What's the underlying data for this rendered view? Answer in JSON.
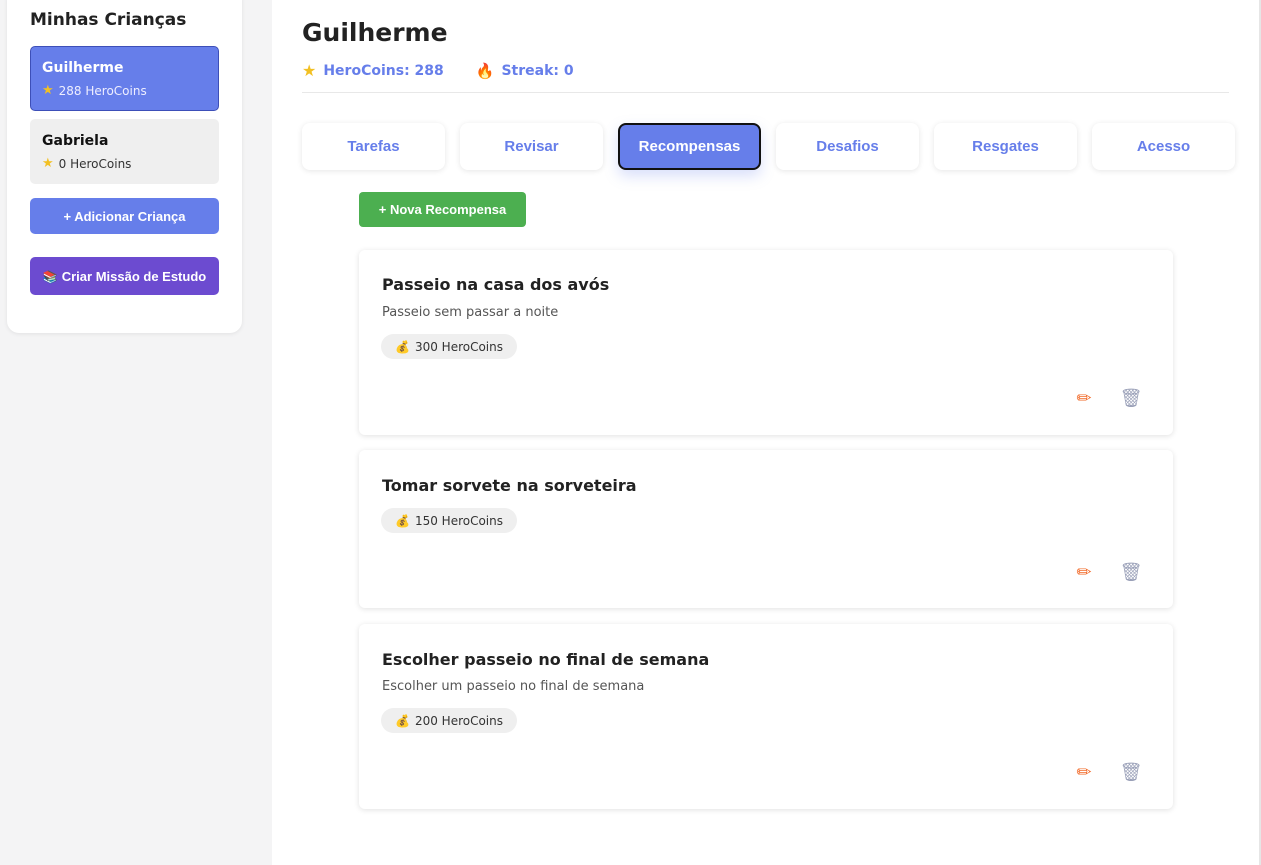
{
  "sidebar": {
    "title": "Minhas Crianças",
    "children": [
      {
        "name": "Guilherme",
        "coins": "288 HeroCoins",
        "active": true
      },
      {
        "name": "Gabriela",
        "coins": "0 HeroCoins",
        "active": false
      }
    ],
    "add_child_label": "+ Adicionar Criança",
    "study_mission_label": "Criar Missão de Estudo"
  },
  "header": {
    "title": "Guilherme",
    "herocoins": "HeroCoins: 288",
    "streak": "Streak: 0"
  },
  "tabs": [
    {
      "label": "Tarefas",
      "active": false
    },
    {
      "label": "Revisar",
      "active": false
    },
    {
      "label": "Recompensas",
      "active": true
    },
    {
      "label": "Desafios",
      "active": false
    },
    {
      "label": "Resgates",
      "active": false
    },
    {
      "label": "Acesso",
      "active": false
    }
  ],
  "new_reward_label": "+ Nova Recompensa",
  "rewards": [
    {
      "title": "Passeio na casa dos avós",
      "description": "Passeio sem passar a noite",
      "price": "300 HeroCoins"
    },
    {
      "title": "Tomar sorvete na sorveteira",
      "description": "",
      "price": "150 HeroCoins"
    },
    {
      "title": "Escolher passeio no final de semana",
      "description": "Escolher um passeio no final de semana",
      "price": "200 HeroCoins"
    }
  ],
  "colors": {
    "accent": "#667eea",
    "success": "#4caf50",
    "purple": "#6c4bd0",
    "edit": "#f26b2a"
  },
  "icons": {
    "star": "star-icon",
    "flame": "flame-icon",
    "books": "books-icon",
    "money_bag": "money-bag-icon",
    "pencil": "pencil-icon",
    "trash": "trash-icon"
  }
}
